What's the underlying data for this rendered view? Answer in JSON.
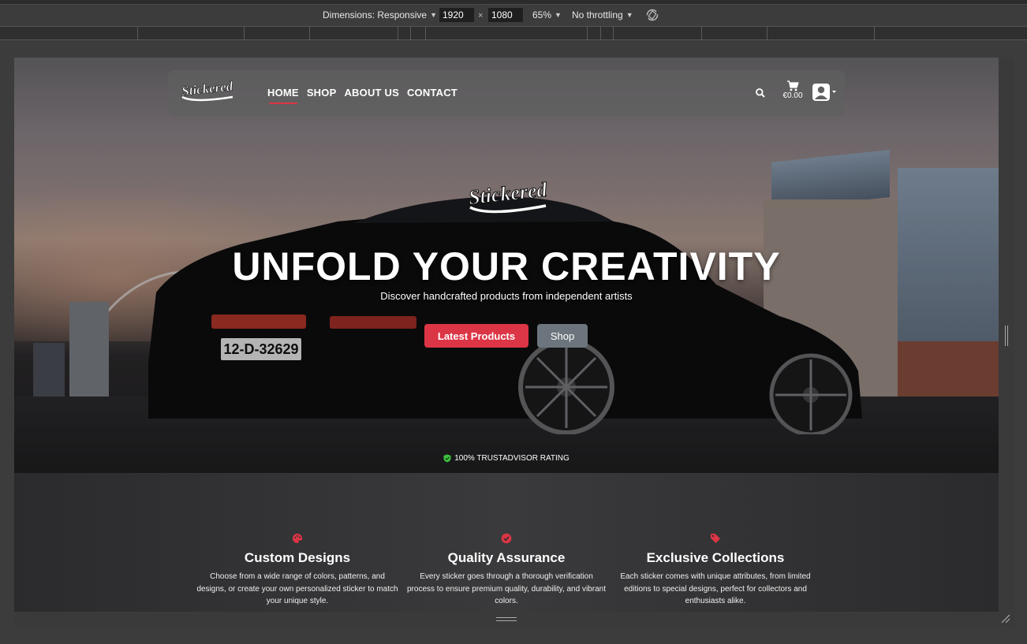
{
  "devtools": {
    "dimensions_label": "Dimensions: Responsive",
    "width": "1920",
    "times": "×",
    "height": "1080",
    "zoom": "65%",
    "throttling": "No throttling"
  },
  "nav": {
    "links": [
      "HOME",
      "SHOP",
      "ABOUT US",
      "CONTACT"
    ],
    "active": "HOME",
    "cart_total": "€0.00"
  },
  "hero": {
    "title": "UNFOLD YOUR CREATIVITY",
    "subtitle": "Discover handcrafted products from independent artists",
    "primary_button": "Latest Products",
    "secondary_button": "Shop",
    "trust": "100% TRUSTADVISOR RATING",
    "license_plate": "12-D-32629"
  },
  "features": [
    {
      "icon": "palette-icon",
      "title": "Custom Designs",
      "text": "Choose from a wide range of colors, patterns, and designs, or create your own personalized sticker to match your unique style."
    },
    {
      "icon": "check-circle-icon",
      "title": "Quality Assurance",
      "text": "Every sticker goes through a thorough verification process to ensure premium quality, durability, and vibrant colors."
    },
    {
      "icon": "tag-icon",
      "title": "Exclusive Collections",
      "text": "Each sticker comes with unique attributes, from limited editions to special designs, perfect for collectors and enthusiasts alike."
    }
  ],
  "colors": {
    "accent": "#dc3545",
    "secondary": "#6c757d",
    "trust_green": "#3fbf3f"
  }
}
